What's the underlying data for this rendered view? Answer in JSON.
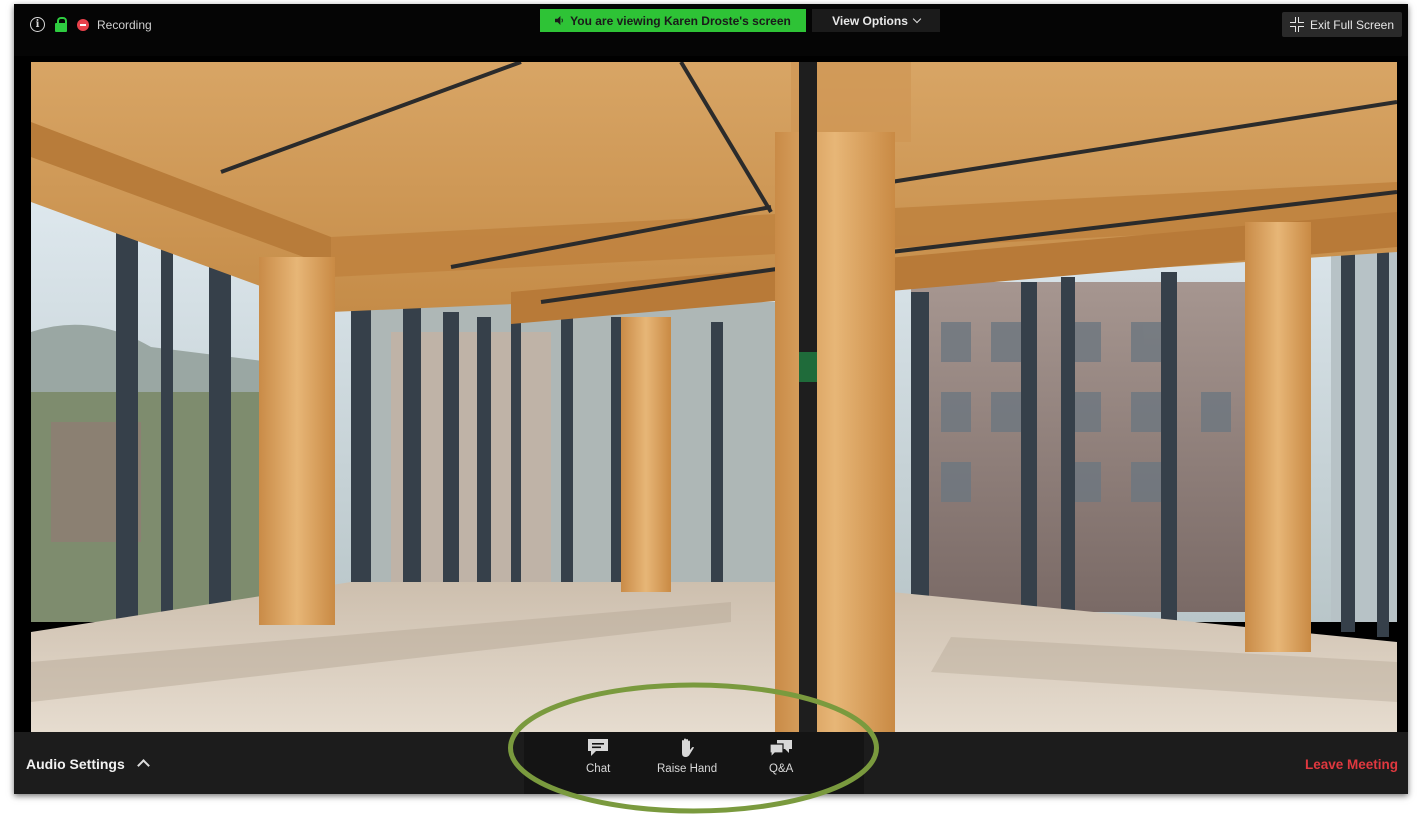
{
  "topbar": {
    "recording_label": "Recording",
    "viewing_banner": "You are viewing Karen Droste's screen",
    "view_options_label": "View Options",
    "exit_fullscreen_label": "Exit Full Screen"
  },
  "toolbar": {
    "audio_settings_label": "Audio Settings",
    "chat_label": "Chat",
    "raise_hand_label": "Raise Hand",
    "qa_label": "Q&A",
    "leave_label": "Leave Meeting"
  },
  "icons": {
    "info": "info-icon",
    "lock": "lock-icon",
    "recording": "recording-icon",
    "speaker": "speaker-icon",
    "chevron": "chevron-down-icon",
    "exit_fullscreen": "exit-fullscreen-icon",
    "caret": "caret-up-icon",
    "chat": "chat-icon",
    "hand": "hand-icon",
    "qa": "qa-icon"
  },
  "colors": {
    "banner_green": "#2ec336",
    "lock_green": "#2ecc40",
    "recording_red": "#e8414b",
    "leave_red": "#e0383f",
    "highlight_ellipse": "#7a9a3e"
  }
}
